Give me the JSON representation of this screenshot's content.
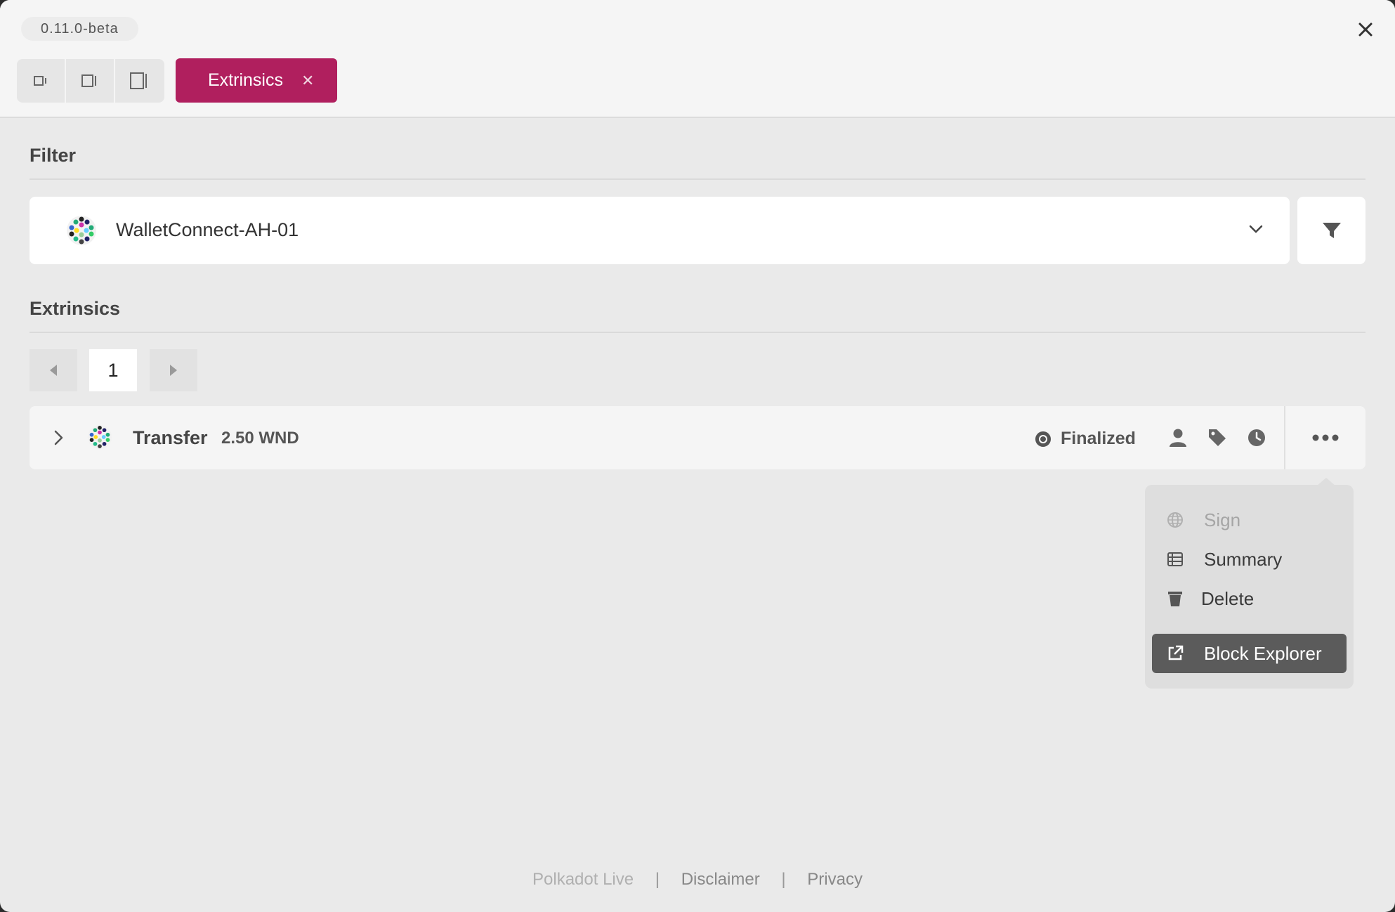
{
  "app": {
    "version": "0.11.0-beta"
  },
  "tabs": [
    {
      "label": "Extrinsics",
      "active": true
    }
  ],
  "filter": {
    "section_title": "Filter",
    "selected_account": "WalletConnect-AH-01"
  },
  "extrinsics": {
    "section_title": "Extrinsics",
    "current_page": "1",
    "rows": [
      {
        "title": "Transfer",
        "amount": "2.50 WND",
        "status": "Finalized"
      }
    ]
  },
  "menu": {
    "items": [
      {
        "label": "Sign",
        "icon": "globe-icon",
        "disabled": true
      },
      {
        "label": "Summary",
        "icon": "list-icon",
        "disabled": false
      },
      {
        "label": "Delete",
        "icon": "trash-icon",
        "disabled": false
      },
      {
        "label": "Block Explorer",
        "icon": "external-link-icon",
        "highlighted": true
      }
    ]
  },
  "footer": {
    "brand": "Polkadot Live",
    "disclaimer": "Disclaimer",
    "privacy": "Privacy",
    "separator": "|"
  },
  "colors": {
    "accent": "#b01f5e",
    "menu_highlight": "#5b5b5b"
  }
}
